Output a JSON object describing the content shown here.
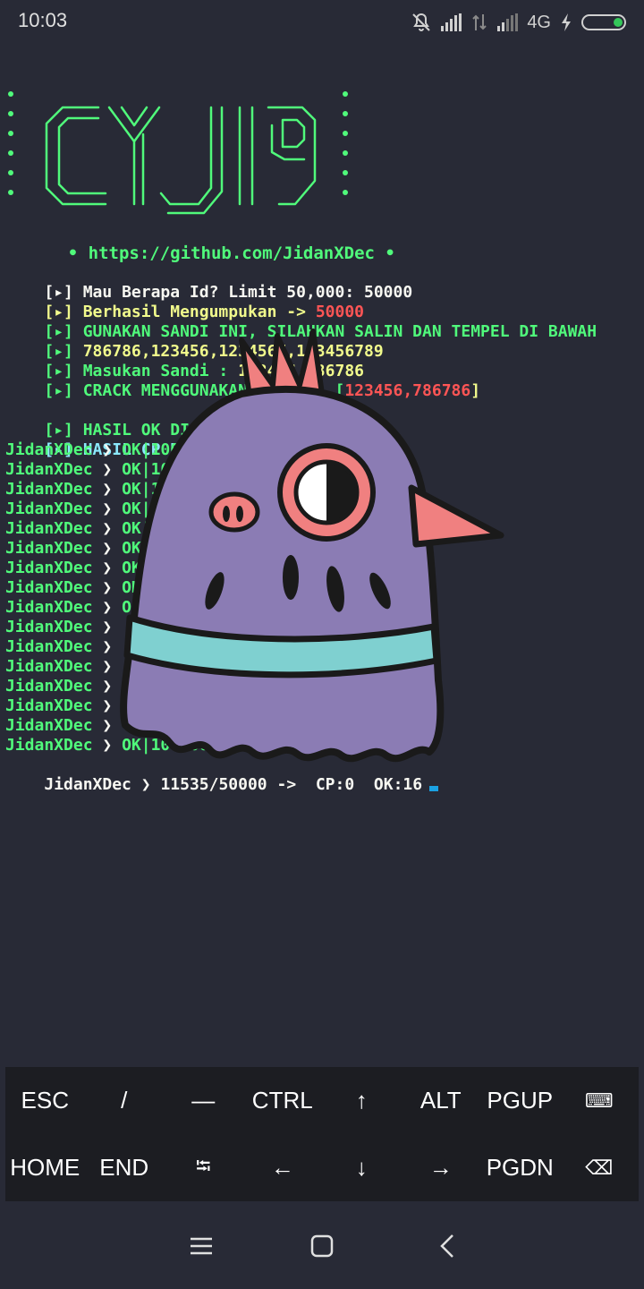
{
  "status_bar": {
    "time": "10:03",
    "network": "4G",
    "icons": [
      "bell-off-icon",
      "signal-icon",
      "data-arrows-icon",
      "signal-icon",
      "charging-icon",
      "battery-icon"
    ],
    "battery_color": "#34c759",
    "battery_level": 0.2
  },
  "banner": {
    "ascii_logo": "CYJI9",
    "color": "#50fa7b",
    "repo_url": "https://github.com/JidanXDec",
    "bullet": "•"
  },
  "prompt_prefix": "[▸]",
  "lines": [
    {
      "text": "Mau Berapa Id? Limit 50,000: 50000",
      "color": "white"
    },
    {
      "text": "Berhasil Mengumpukan -> ",
      "value": "50000",
      "color": "yellow"
    },
    {
      "text": "GUNAKAN SANDI INI, SILAHKAN SALIN DAN TEMPEL DI BAWAH",
      "color": "green"
    },
    {
      "text": "786786,123456,1234567,123456789",
      "color": "yellow"
    },
    {
      "text": "Masukan Sandi : ",
      "value": "123456,786786",
      "color": "green"
    },
    {
      "text": "CRACK MENGGUNAKAN SANDI : [",
      "value": "123456,786786",
      "suffix": "]",
      "color": "green"
    },
    {
      "text": "HASIL OK DISIMPAN DI",
      "color": "green"
    },
    {
      "text": "HASIL CP DISIMPAN D",
      "color": "cyan"
    }
  ],
  "results": [
    {
      "user": "JidanXDec",
      "arrow": "❯",
      "text": "OK|10000"
    },
    {
      "user": "JidanXDec",
      "arrow": "❯",
      "text": "OK|1000"
    },
    {
      "user": "JidanXDec",
      "arrow": "❯",
      "text": "OK|10"
    },
    {
      "user": "JidanXDec",
      "arrow": "❯",
      "text": "OK|10"
    },
    {
      "user": "JidanXDec",
      "arrow": "❯",
      "text": "OK|1"
    },
    {
      "user": "JidanXDec",
      "arrow": "❯",
      "text": "OK|"
    },
    {
      "user": "JidanXDec",
      "arrow": "❯",
      "text": "OK"
    },
    {
      "user": "JidanXDec",
      "arrow": "❯",
      "text": "OK"
    },
    {
      "user": "JidanXDec",
      "arrow": "❯",
      "text": "O"
    },
    {
      "user": "JidanXDec",
      "arrow": "❯",
      "text": ""
    },
    {
      "user": "JidanXDec",
      "arrow": "❯",
      "text": ""
    },
    {
      "user": "JidanXDec",
      "arrow": "❯",
      "text": ""
    },
    {
      "user": "JidanXDec",
      "arrow": "❯",
      "text": ""
    },
    {
      "user": "JidanXDec",
      "arrow": "❯",
      "text": ""
    },
    {
      "user": "JidanXDec",
      "arrow": "❯",
      "text": ""
    },
    {
      "user": "JidanXDec",
      "arrow": "❯",
      "text": "OK|100000"
    }
  ],
  "progress_line": {
    "user": "JidanXDec",
    "arrow": "❯",
    "count": "11535/50000 ->",
    "cp": "CP:0",
    "ok": "OK:16"
  },
  "extra_keys": {
    "row1": [
      "ESC",
      "/",
      "—",
      "CTRL",
      "↑",
      "ALT",
      "PGUP",
      "⌨"
    ],
    "row2": [
      "HOME",
      "END",
      "⭾",
      "←",
      "↓",
      "→",
      "PGDN",
      "⌫"
    ]
  },
  "nav": {
    "items": [
      "menu-icon",
      "home-icon",
      "back-icon"
    ]
  }
}
